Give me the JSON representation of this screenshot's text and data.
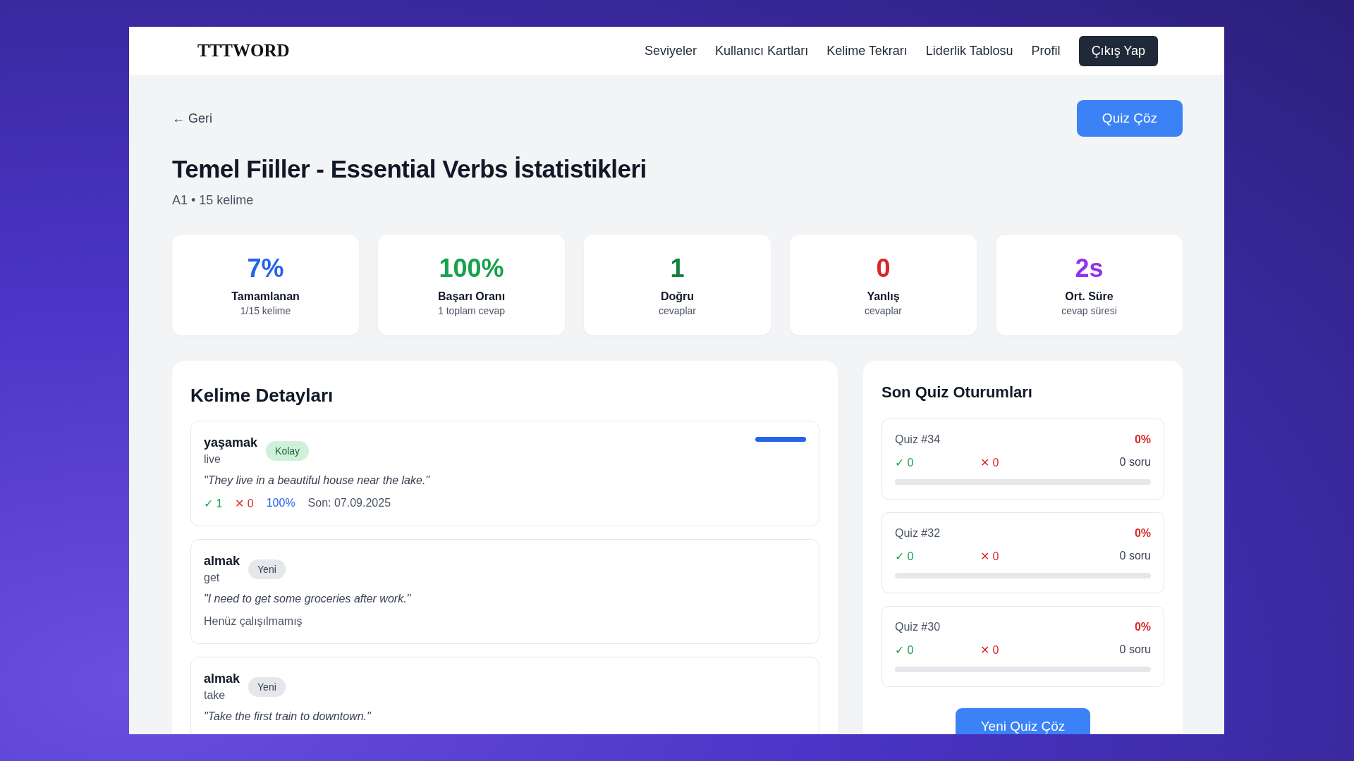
{
  "navbar": {
    "logo": "TTTWORD",
    "links": [
      "Seviyeler",
      "Kullanıcı Kartları",
      "Kelime Tekrarı",
      "Liderlik Tablosu",
      "Profil"
    ],
    "logout": "Çıkış Yap"
  },
  "header": {
    "back": "← Geri",
    "quiz_button": "Quiz Çöz",
    "title": "Temel Fiiller - Essential Verbs İstatistikleri",
    "subtitle": "A1 • 15 kelime"
  },
  "stats": [
    {
      "value": "7%",
      "label": "Tamamlanan",
      "sub": "1/15 kelime",
      "color": "#2563eb"
    },
    {
      "value": "100%",
      "label": "Başarı Oranı",
      "sub": "1 toplam cevap",
      "color": "#16a34a"
    },
    {
      "value": "1",
      "label": "Doğru",
      "sub": "cevaplar",
      "color": "#15803d"
    },
    {
      "value": "0",
      "label": "Yanlış",
      "sub": "cevaplar",
      "color": "#dc2626"
    },
    {
      "value": "2s",
      "label": "Ort. Süre",
      "sub": "cevap süresi",
      "color": "#9333ea"
    }
  ],
  "words_panel": {
    "title": "Kelime Detayları",
    "words": [
      {
        "word": "yaşamak",
        "meaning": "live",
        "tag": {
          "label": "Kolay",
          "kind": "easy"
        },
        "example": "\"They live in a beautiful house near the lake.\"",
        "level": 1,
        "stats": {
          "correct": "✓ 1",
          "wrong": "✕ 0",
          "rate": "100%",
          "last": "Son: 07.09.2025"
        }
      },
      {
        "word": "almak",
        "meaning": "get",
        "tag": {
          "label": "Yeni",
          "kind": "new"
        },
        "example": "\"I need to get some groceries after work.\"",
        "note": "Henüz çalışılmamış"
      },
      {
        "word": "almak",
        "meaning": "take",
        "tag": {
          "label": "Yeni",
          "kind": "new"
        },
        "example": "\"Take the first train to downtown.\""
      }
    ]
  },
  "sessions_panel": {
    "title": "Son Quiz Oturumları",
    "sessions": [
      {
        "name": "Quiz #34",
        "percent": "0%",
        "correct": "✓ 0",
        "wrong": "✕ 0",
        "questions": "0 soru",
        "level": 0
      },
      {
        "name": "Quiz #32",
        "percent": "0%",
        "correct": "✓ 0",
        "wrong": "✕ 0",
        "questions": "0 soru",
        "level": 0
      },
      {
        "name": "Quiz #30",
        "percent": "0%",
        "correct": "✓ 0",
        "wrong": "✕ 0",
        "questions": "0 soru",
        "level": 0
      }
    ],
    "button": "Yeni Quiz Çöz"
  }
}
